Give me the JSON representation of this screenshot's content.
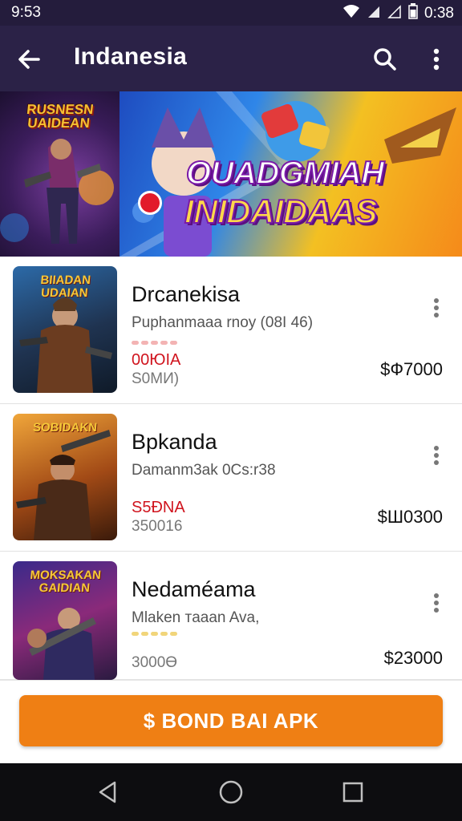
{
  "status": {
    "time_left": "9:53",
    "time_right": "0:38"
  },
  "app_bar": {
    "title": "Indanesia"
  },
  "banner": {
    "left_title": "RUSNESN UAIDEAN",
    "headline_line1": "OUADGMIAH",
    "headline_line2": "INIDAIDAAS"
  },
  "items": [
    {
      "thumb_title": "BIIADAN UDAIAN",
      "title": "Drcanekisa",
      "subtitle": "Puphanmaaa rnoy (08I 46)",
      "price_red": "00ЮIA",
      "price_grey": "S0MИ)",
      "price": "$Ф7000",
      "dots": "red"
    },
    {
      "thumb_title": "SOBIDAKN",
      "title": "Bpkanda",
      "subtitle": "Damanm3ak 0Cs:r38",
      "price_red": "S5ÐNA",
      "price_grey": "350016",
      "price": "$Ш0300",
      "dots": "none"
    },
    {
      "thumb_title": "MOKSAKAN GAIDIAN",
      "title": "Nedaméama",
      "subtitle": "Mlaken тaaan Ava,",
      "price_red": "",
      "price_grey": "3000Ө",
      "price": "$23000",
      "dots": "yellow"
    }
  ],
  "action": {
    "label": "$ BOND BAI APK"
  },
  "colors": {
    "app_bar": "#2b2247",
    "accent": "#ef7f14",
    "price_red": "#d0141e"
  }
}
